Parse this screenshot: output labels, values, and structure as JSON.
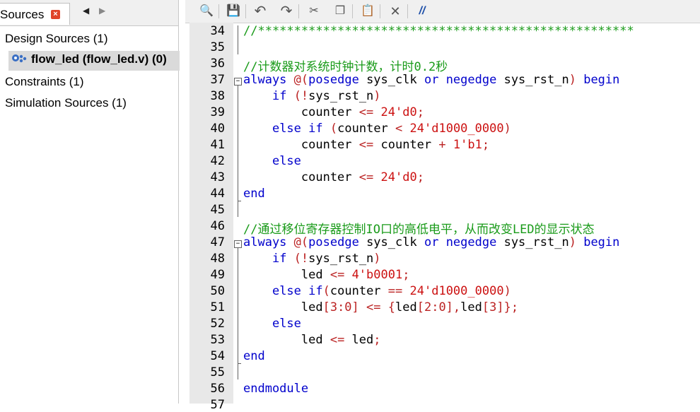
{
  "sources_panel": {
    "tab_label": "Sources",
    "close_glyph": "×",
    "nav_prev": "◀",
    "nav_next": "▶",
    "tree": [
      {
        "label": "Design Sources (1)"
      },
      {
        "label": "flow_led (flow_led.v) (0)"
      },
      {
        "label": "Constraints (1)"
      },
      {
        "label": "Simulation Sources (1)"
      }
    ]
  },
  "toolbar": {
    "icons": [
      "search-icon",
      "save-icon",
      "undo-icon",
      "redo-icon",
      "cut-icon",
      "copy-icon",
      "paste-icon",
      "close-icon",
      "comment-icon"
    ],
    "glyphs": {
      "search": "🔍",
      "save": "💾",
      "undo": "↶",
      "redo": "↷",
      "cut": "✂",
      "copy": "❐",
      "paste": "📋",
      "close": "✕",
      "comment": "//"
    }
  },
  "colors": {
    "keyword": "#0000cc",
    "comment": "#1a9b1a",
    "operator": "#bb2222",
    "number": "#cc1111"
  },
  "editor": {
    "lines": [
      {
        "n": "34",
        "tokens": [
          {
            "t": "//****************************************************",
            "c": "cm"
          }
        ]
      },
      {
        "n": "35",
        "tokens": []
      },
      {
        "n": "36",
        "tokens": [
          {
            "t": "//计数器对系统时钟计数，计时0.2秒",
            "c": "cm"
          }
        ]
      },
      {
        "n": "37",
        "tokens": [
          {
            "t": "always",
            "c": "kw"
          },
          {
            "t": " ",
            "c": ""
          },
          {
            "t": "@",
            "c": "op"
          },
          {
            "t": "(",
            "c": "op"
          },
          {
            "t": "posedge",
            "c": "kw"
          },
          {
            "t": " sys_clk ",
            "c": ""
          },
          {
            "t": "or",
            "c": "kw"
          },
          {
            "t": " ",
            "c": ""
          },
          {
            "t": "negedge",
            "c": "kw"
          },
          {
            "t": " sys_rst_n",
            "c": ""
          },
          {
            "t": ")",
            "c": "op"
          },
          {
            "t": " ",
            "c": ""
          },
          {
            "t": "begin",
            "c": "kw"
          }
        ]
      },
      {
        "n": "38",
        "tokens": [
          {
            "t": "    ",
            "c": ""
          },
          {
            "t": "if",
            "c": "kw"
          },
          {
            "t": " ",
            "c": ""
          },
          {
            "t": "(!",
            "c": "op"
          },
          {
            "t": "sys_rst_n",
            "c": ""
          },
          {
            "t": ")",
            "c": "op"
          }
        ]
      },
      {
        "n": "39",
        "tokens": [
          {
            "t": "        counter ",
            "c": ""
          },
          {
            "t": "<=",
            "c": "op"
          },
          {
            "t": " ",
            "c": ""
          },
          {
            "t": "24'd0",
            "c": "num"
          },
          {
            "t": ";",
            "c": "op"
          }
        ]
      },
      {
        "n": "40",
        "tokens": [
          {
            "t": "    ",
            "c": ""
          },
          {
            "t": "else",
            "c": "kw"
          },
          {
            "t": " ",
            "c": ""
          },
          {
            "t": "if",
            "c": "kw"
          },
          {
            "t": " ",
            "c": ""
          },
          {
            "t": "(",
            "c": "op"
          },
          {
            "t": "counter ",
            "c": ""
          },
          {
            "t": "<",
            "c": "op"
          },
          {
            "t": " ",
            "c": ""
          },
          {
            "t": "24'd1000_0000",
            "c": "num"
          },
          {
            "t": ")",
            "c": "op"
          }
        ]
      },
      {
        "n": "41",
        "tokens": [
          {
            "t": "        counter ",
            "c": ""
          },
          {
            "t": "<=",
            "c": "op"
          },
          {
            "t": " counter ",
            "c": ""
          },
          {
            "t": "+",
            "c": "op"
          },
          {
            "t": " ",
            "c": ""
          },
          {
            "t": "1'b1",
            "c": "num"
          },
          {
            "t": ";",
            "c": "op"
          }
        ]
      },
      {
        "n": "42",
        "tokens": [
          {
            "t": "    ",
            "c": ""
          },
          {
            "t": "else",
            "c": "kw"
          }
        ]
      },
      {
        "n": "43",
        "tokens": [
          {
            "t": "        counter ",
            "c": ""
          },
          {
            "t": "<=",
            "c": "op"
          },
          {
            "t": " ",
            "c": ""
          },
          {
            "t": "24'd0",
            "c": "num"
          },
          {
            "t": ";",
            "c": "op"
          }
        ]
      },
      {
        "n": "44",
        "tokens": [
          {
            "t": "end",
            "c": "kw"
          }
        ]
      },
      {
        "n": "45",
        "tokens": []
      },
      {
        "n": "46",
        "tokens": [
          {
            "t": "//通过移位寄存器控制IO口的高低电平，从而改变LED的显示状态",
            "c": "cm"
          }
        ]
      },
      {
        "n": "47",
        "tokens": [
          {
            "t": "always",
            "c": "kw"
          },
          {
            "t": " ",
            "c": ""
          },
          {
            "t": "@",
            "c": "op"
          },
          {
            "t": "(",
            "c": "op"
          },
          {
            "t": "posedge",
            "c": "kw"
          },
          {
            "t": " sys_clk ",
            "c": ""
          },
          {
            "t": "or",
            "c": "kw"
          },
          {
            "t": " ",
            "c": ""
          },
          {
            "t": "negedge",
            "c": "kw"
          },
          {
            "t": " sys_rst_n",
            "c": ""
          },
          {
            "t": ")",
            "c": "op"
          },
          {
            "t": " ",
            "c": ""
          },
          {
            "t": "begin",
            "c": "kw"
          }
        ]
      },
      {
        "n": "48",
        "tokens": [
          {
            "t": "    ",
            "c": ""
          },
          {
            "t": "if",
            "c": "kw"
          },
          {
            "t": " ",
            "c": ""
          },
          {
            "t": "(!",
            "c": "op"
          },
          {
            "t": "sys_rst_n",
            "c": ""
          },
          {
            "t": ")",
            "c": "op"
          }
        ]
      },
      {
        "n": "49",
        "tokens": [
          {
            "t": "        led ",
            "c": ""
          },
          {
            "t": "<=",
            "c": "op"
          },
          {
            "t": " ",
            "c": ""
          },
          {
            "t": "4'b0001",
            "c": "num"
          },
          {
            "t": ";",
            "c": "op"
          }
        ]
      },
      {
        "n": "50",
        "tokens": [
          {
            "t": "    ",
            "c": ""
          },
          {
            "t": "else",
            "c": "kw"
          },
          {
            "t": " ",
            "c": ""
          },
          {
            "t": "if",
            "c": "kw"
          },
          {
            "t": "(",
            "c": "op"
          },
          {
            "t": "counter ",
            "c": ""
          },
          {
            "t": "==",
            "c": "op"
          },
          {
            "t": " ",
            "c": ""
          },
          {
            "t": "24'd1000_0000",
            "c": "num"
          },
          {
            "t": ")",
            "c": "op"
          }
        ]
      },
      {
        "n": "51",
        "tokens": [
          {
            "t": "        led",
            "c": ""
          },
          {
            "t": "[3:0]",
            "c": "op"
          },
          {
            "t": " ",
            "c": ""
          },
          {
            "t": "<=",
            "c": "op"
          },
          {
            "t": " ",
            "c": ""
          },
          {
            "t": "{",
            "c": "op"
          },
          {
            "t": "led",
            "c": ""
          },
          {
            "t": "[2:0],",
            "c": "op"
          },
          {
            "t": "led",
            "c": ""
          },
          {
            "t": "[3]};",
            "c": "op"
          }
        ]
      },
      {
        "n": "52",
        "tokens": [
          {
            "t": "    ",
            "c": ""
          },
          {
            "t": "else",
            "c": "kw"
          }
        ]
      },
      {
        "n": "53",
        "tokens": [
          {
            "t": "        led ",
            "c": ""
          },
          {
            "t": "<=",
            "c": "op"
          },
          {
            "t": " led",
            "c": ""
          },
          {
            "t": ";",
            "c": "op"
          }
        ]
      },
      {
        "n": "54",
        "tokens": [
          {
            "t": "end",
            "c": "kw"
          }
        ]
      },
      {
        "n": "55",
        "tokens": []
      },
      {
        "n": "56",
        "tokens": [
          {
            "t": "endmodule",
            "c": "kw"
          }
        ]
      },
      {
        "n": "57",
        "tokens": []
      }
    ]
  }
}
